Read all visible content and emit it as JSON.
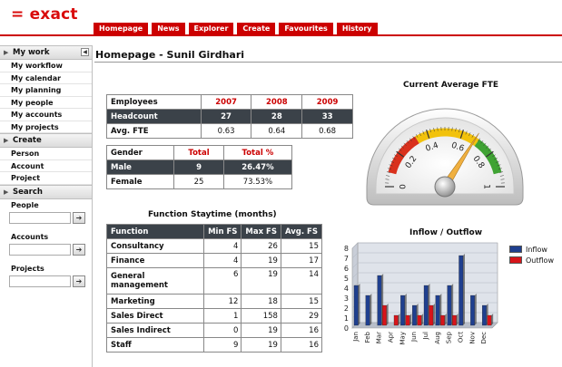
{
  "app": {
    "logo": "= exact"
  },
  "nav": [
    "Homepage",
    "News",
    "Explorer",
    "Create",
    "Favourites",
    "History"
  ],
  "sidebar": {
    "my_work": {
      "title": "My work",
      "items": [
        "My workflow",
        "My calendar",
        "My planning",
        "My people",
        "My accounts",
        "My projects"
      ]
    },
    "create": {
      "title": "Create",
      "items": [
        "Person",
        "Account",
        "Project"
      ]
    },
    "search": {
      "title": "Search",
      "fields": [
        "People",
        "Accounts",
        "Projects"
      ],
      "go": "➔"
    }
  },
  "page": {
    "title": "Homepage - Sunil Girdhari"
  },
  "fte_table": {
    "header": [
      "Employees",
      "2007",
      "2008",
      "2009"
    ],
    "rows": [
      {
        "label": "Headcount",
        "values": [
          "27",
          "28",
          "33"
        ]
      },
      {
        "label": "Avg. FTE",
        "values": [
          "0.63",
          "0.64",
          "0.68"
        ]
      }
    ]
  },
  "gender_table": {
    "header": [
      "Gender",
      "Total",
      "Total %"
    ],
    "rows": [
      {
        "label": "Male",
        "values": [
          "9",
          "26.47%"
        ]
      },
      {
        "label": "Female",
        "values": [
          "25",
          "73.53%"
        ]
      }
    ]
  },
  "staytime": {
    "title": "Function Staytime (months)",
    "header": [
      "Function",
      "Min FS",
      "Max FS",
      "Avg. FS"
    ],
    "rows": [
      {
        "label": "Consultancy",
        "values": [
          "4",
          "26",
          "15"
        ]
      },
      {
        "label": "Finance",
        "values": [
          "4",
          "19",
          "17"
        ]
      },
      {
        "label": "General management",
        "values": [
          "6",
          "19",
          "14"
        ]
      },
      {
        "label": "Marketing",
        "values": [
          "12",
          "18",
          "15"
        ]
      },
      {
        "label": "Sales Direct",
        "values": [
          "1",
          "158",
          "29"
        ]
      },
      {
        "label": "Sales Indirect",
        "values": [
          "0",
          "19",
          "16"
        ]
      },
      {
        "label": "Staff",
        "values": [
          "9",
          "19",
          "16"
        ]
      }
    ]
  },
  "gauge": {
    "title": "Current Average FTE",
    "value": 0.68,
    "min": 0,
    "max": 1,
    "ticks": [
      "0",
      "0.2",
      "0.4",
      "0.6",
      "0.8",
      "1"
    ],
    "colors": {
      "red": "#d9301c",
      "yellow": "#f2c20c",
      "green": "#3fa333",
      "needle": "#f0b040"
    }
  },
  "chart_data": {
    "type": "bar",
    "title": "Inflow / Outflow",
    "categories": [
      "Jan",
      "Feb",
      "Mar",
      "Apr",
      "May",
      "Jun",
      "Jul",
      "Aug",
      "Sep",
      "Oct",
      "Nov",
      "Dec"
    ],
    "series": [
      {
        "name": "Inflow",
        "color": "#1f3f8f",
        "values": [
          4,
          3,
          5,
          0,
          3,
          2,
          4,
          3,
          4,
          7,
          3,
          2
        ]
      },
      {
        "name": "Outflow",
        "color": "#d7141a",
        "values": [
          0,
          0,
          2,
          1,
          1,
          1,
          2,
          1,
          1,
          0,
          0,
          1
        ]
      }
    ],
    "yticks": [
      "0",
      "1",
      "2",
      "3",
      "4",
      "5",
      "6",
      "7",
      "8"
    ],
    "ylim": [
      0,
      8
    ],
    "legend": "right"
  }
}
